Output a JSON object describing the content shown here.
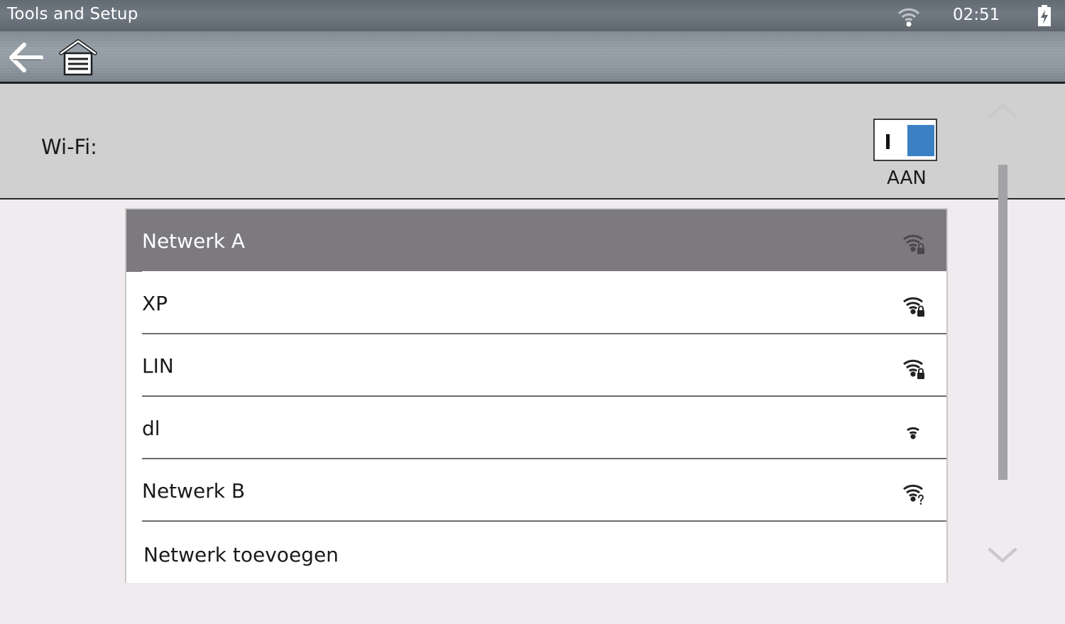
{
  "status_bar": {
    "title": "Tools and Setup",
    "time": "02:51",
    "wifi_icon": "wifi-icon",
    "battery_icon": "battery-charging-icon"
  },
  "toolbar": {
    "back_icon": "back-arrow-icon",
    "home_icon": "garage-home-icon"
  },
  "wifi": {
    "label": "Wi-Fi:",
    "toggle_state": "AAN",
    "toggle_mark": "I",
    "toggle_on": true,
    "accent_color": "#3a80c3"
  },
  "networks": [
    {
      "name": "Netwerk A",
      "icon": "wifi-locked-icon",
      "selected": true
    },
    {
      "name": "XP",
      "icon": "wifi-locked-icon",
      "selected": false
    },
    {
      "name": "LIN",
      "icon": "wifi-locked-icon",
      "selected": false
    },
    {
      "name": "dl",
      "icon": "wifi-weak-icon",
      "selected": false
    },
    {
      "name": "Netwerk B",
      "icon": "wifi-unknown-icon",
      "selected": false
    }
  ],
  "add_network": {
    "label": "Netwerk toevoegen"
  },
  "scroll": {
    "up_icon": "chevron-up-icon",
    "down_icon": "chevron-down-icon"
  }
}
